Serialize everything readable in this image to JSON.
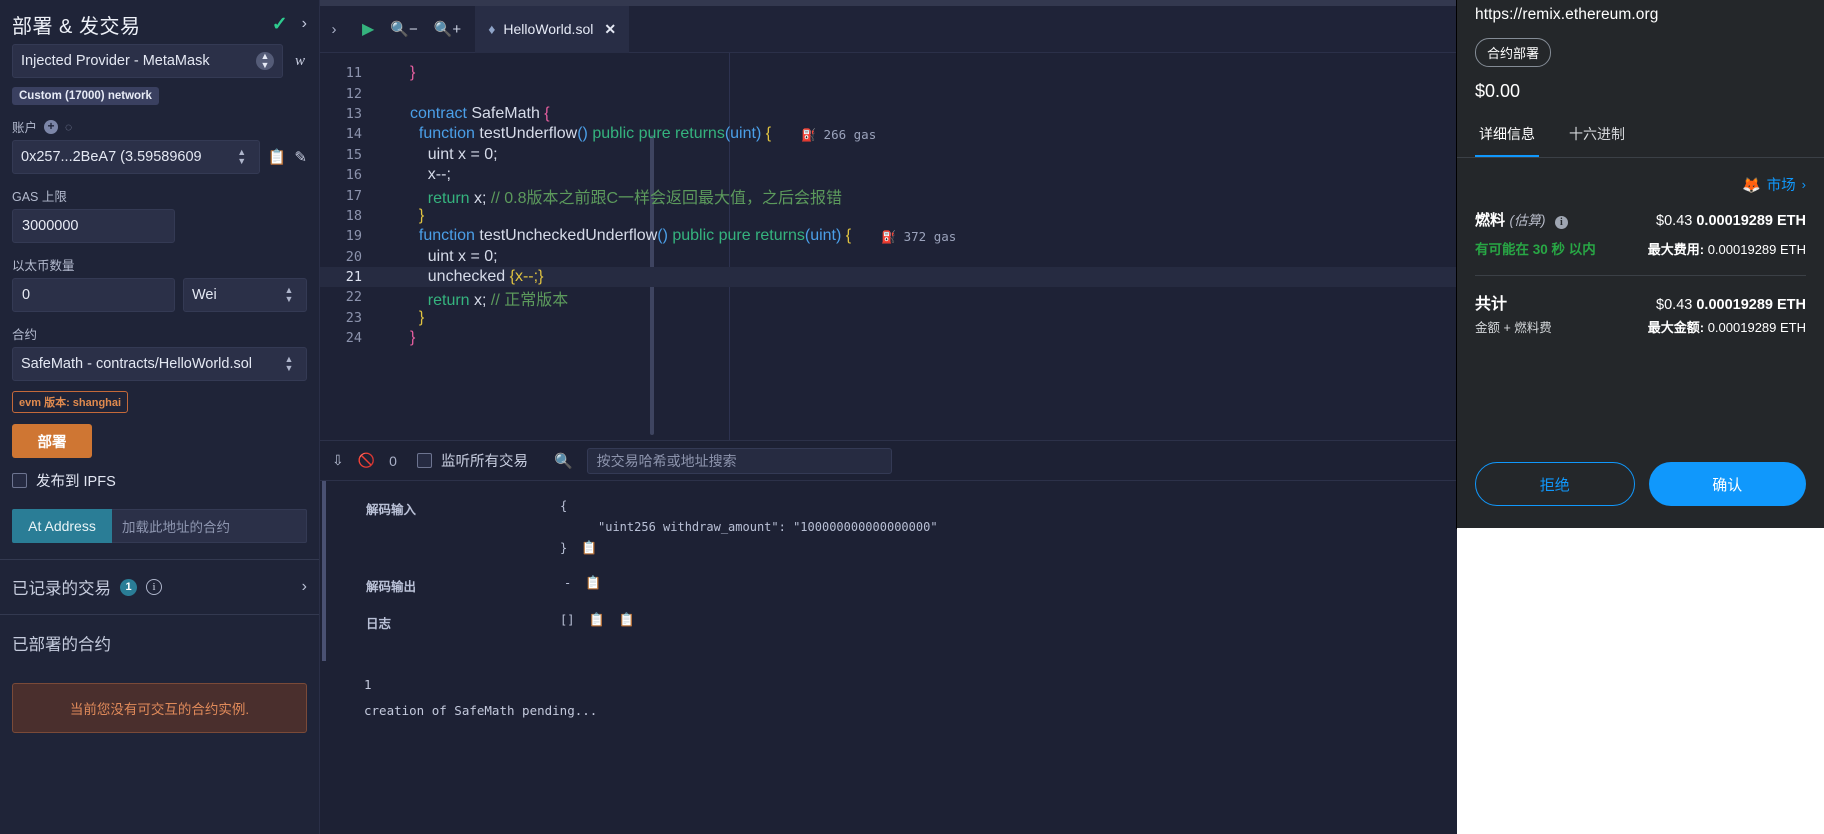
{
  "left_panel": {
    "title": "部署 & 发交易",
    "check_icon": "check-icon",
    "chevron_icon": "chevron-right-icon",
    "environment": {
      "label": "",
      "value": "Injected Provider - MetaMask",
      "network_badge": "Custom (17000) network",
      "info_icon": "info-icon"
    },
    "account": {
      "label": "账户",
      "value": "0x257...2BeA7 (3.59589609",
      "add_icon": "plus-circle-icon",
      "loading_icon": "spinner-icon",
      "copy_icon": "copy-icon",
      "edit_icon": "edit-icon"
    },
    "gas_limit": {
      "label": "GAS 上限",
      "value": "3000000"
    },
    "value": {
      "label": "以太币数量",
      "amount": "0",
      "unit": "Wei"
    },
    "contract": {
      "label": "合约",
      "value": "SafeMath - contracts/HelloWorld.sol",
      "evm_badge": "evm 版本: shanghai"
    },
    "deploy_button": "部署",
    "publish_ipfs": "发布到 IPFS",
    "at_address_button": "At Address",
    "at_address_placeholder": "加载此地址的合约",
    "recorded_transactions": {
      "label": "已记录的交易",
      "count": "1",
      "info_icon": "info-circle-icon",
      "chevron_icon": "chevron-right-icon"
    },
    "deployed_contracts": {
      "label": "已部署的合约"
    },
    "no_contract_warning": "当前您没有可交互的合约实例."
  },
  "editor": {
    "toolbar": {
      "expand_icon": "chevron-right-icon",
      "run_icon": "play-icon",
      "zoom_out_icon": "zoom-out-icon",
      "zoom_in_icon": "zoom-in-icon"
    },
    "tab": {
      "filename": "HelloWorld.sol",
      "file_icon": "solidity-icon",
      "close_icon": "close-icon"
    },
    "lines": [
      {
        "num": "11",
        "tokens": [
          {
            "t": "}",
            "c": "k-brace-p"
          }
        ]
      },
      {
        "num": "12",
        "tokens": []
      },
      {
        "num": "13",
        "tokens": [
          {
            "t": "contract ",
            "c": "k-kw"
          },
          {
            "t": "SafeMath ",
            "c": "k-name"
          },
          {
            "t": "{",
            "c": "k-brace-p"
          }
        ]
      },
      {
        "num": "14",
        "tokens": [
          {
            "t": "  ",
            "c": "k-punc"
          },
          {
            "t": "function ",
            "c": "k-fn"
          },
          {
            "t": "testUnderflow",
            "c": "k-name"
          },
          {
            "t": "()",
            "c": "k-type"
          },
          {
            "t": " ",
            "c": "k-punc"
          },
          {
            "t": "public pure ",
            "c": "k-mod"
          },
          {
            "t": "returns",
            "c": "k-ret"
          },
          {
            "t": "(uint)",
            "c": "k-type"
          },
          {
            "t": " ",
            "c": "k-punc"
          },
          {
            "t": "{",
            "c": "k-brace-y"
          }
        ],
        "gas": "266 gas"
      },
      {
        "num": "15",
        "tokens": [
          {
            "t": "    ",
            "c": "k-punc"
          },
          {
            "t": "uint",
            "c": "k-punc"
          },
          {
            "t": " x = ",
            "c": "k-punc"
          },
          {
            "t": "0;",
            "c": "k-num"
          }
        ]
      },
      {
        "num": "16",
        "tokens": [
          {
            "t": "    x--;",
            "c": "k-punc"
          }
        ]
      },
      {
        "num": "17",
        "tokens": [
          {
            "t": "    ",
            "c": "k-punc"
          },
          {
            "t": "return",
            "c": "k-mod"
          },
          {
            "t": " x; ",
            "c": "k-punc"
          },
          {
            "t": "// 0.8版本之前跟C一样会返回最大值，之后会报错",
            "c": "k-com"
          }
        ]
      },
      {
        "num": "18",
        "tokens": [
          {
            "t": "  }",
            "c": "k-brace-y"
          }
        ]
      },
      {
        "num": "19",
        "tokens": [
          {
            "t": "  ",
            "c": "k-punc"
          },
          {
            "t": "function ",
            "c": "k-fn"
          },
          {
            "t": "testUncheckedUnderflow",
            "c": "k-name"
          },
          {
            "t": "()",
            "c": "k-type"
          },
          {
            "t": " ",
            "c": "k-punc"
          },
          {
            "t": "public pure ",
            "c": "k-mod"
          },
          {
            "t": "returns",
            "c": "k-ret"
          },
          {
            "t": "(uint)",
            "c": "k-type"
          },
          {
            "t": " ",
            "c": "k-punc"
          },
          {
            "t": "{",
            "c": "k-brace-y"
          }
        ],
        "gas": "372 gas"
      },
      {
        "num": "20",
        "tokens": [
          {
            "t": "    ",
            "c": "k-punc"
          },
          {
            "t": "uint",
            "c": "k-punc"
          },
          {
            "t": " x = ",
            "c": "k-punc"
          },
          {
            "t": "0;",
            "c": "k-num"
          }
        ]
      },
      {
        "num": "21",
        "tokens": [
          {
            "t": "    unchecked ",
            "c": "k-punc"
          },
          {
            "t": "{x--;}",
            "c": "k-brace-y"
          }
        ],
        "highlight": true
      },
      {
        "num": "22",
        "tokens": [
          {
            "t": "    ",
            "c": "k-punc"
          },
          {
            "t": "return",
            "c": "k-mod"
          },
          {
            "t": " x; ",
            "c": "k-punc"
          },
          {
            "t": "// 正常版本",
            "c": "k-com"
          }
        ]
      },
      {
        "num": "23",
        "tokens": [
          {
            "t": "  }",
            "c": "k-brace-y"
          }
        ]
      },
      {
        "num": "24",
        "tokens": [
          {
            "t": "}",
            "c": "k-brace-p"
          }
        ]
      }
    ]
  },
  "terminal": {
    "collapse_icon": "double-chevron-down-icon",
    "clear_icon": "ban-icon",
    "count": "0",
    "listen_label": "监听所有交易",
    "search_icon": "search-icon",
    "search_placeholder": "按交易哈希或地址搜索",
    "decoded_input": {
      "label": "解码输入",
      "open_brace": "{",
      "entry": "\"uint256 withdraw_amount\": \"100000000000000000\"",
      "close_brace": "}",
      "copy_icon": "copy-icon"
    },
    "decoded_output": {
      "label": "解码输出",
      "value": "-",
      "copy_icon": "copy-icon"
    },
    "logs": {
      "label": "日志",
      "value": "[]",
      "copy_icon": "copy-icon",
      "copy_icon2": "copy-icon"
    },
    "status_number": "1",
    "status_text": "creation of SafeMath pending..."
  },
  "metamask": {
    "url": "https://remix.ethereum.org",
    "origin_badge": "合约部署",
    "amount": "$0.00",
    "tabs": [
      {
        "label": "详细信息",
        "active": true
      },
      {
        "label": "十六进制",
        "active": false
      }
    ],
    "market_link": {
      "label": "市场",
      "icon": "fox-icon",
      "chevron": "chevron-right-icon"
    },
    "gas": {
      "title": "燃料",
      "subtitle": "(估算)",
      "info_icon": "info-icon",
      "fiat": "$0.43",
      "eth": "0.00019289 ETH",
      "speed": "有可能在 30 秒 以内",
      "max_label": "最大费用:",
      "max_value": "0.00019289 ETH"
    },
    "total": {
      "title": "共计",
      "subtitle": "金额 + 燃料费",
      "fiat": "$0.43",
      "eth": "0.00019289 ETH",
      "max_label": "最大金额:",
      "max_value": "0.00019289 ETH"
    },
    "reject_button": "拒绝",
    "confirm_button": "确认"
  },
  "colors": {
    "accent_orange": "#cf7633",
    "accent_blue": "#1098fc",
    "teal": "#2a7d96",
    "green": "#28a745"
  }
}
